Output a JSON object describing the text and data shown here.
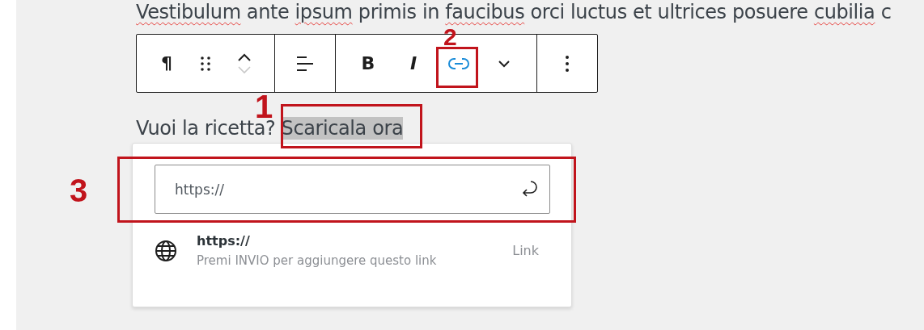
{
  "paragraph_1": [
    {
      "text": "Vestibulum",
      "misspelled": true
    },
    {
      "text": " ante ",
      "misspelled": false
    },
    {
      "text": "ipsum",
      "misspelled": true
    },
    {
      "text": " primis in ",
      "misspelled": false
    },
    {
      "text": "faucibus",
      "misspelled": true
    },
    {
      "text": " orci luctus et ultrices posuere ",
      "misspelled": false
    },
    {
      "text": "cubilia",
      "misspelled": true
    },
    {
      "text": " c",
      "misspelled": false
    }
  ],
  "toolbar": [
    [
      {
        "kind": "paragraph",
        "label": "¶"
      },
      {
        "kind": "drag"
      },
      {
        "kind": "mover"
      }
    ],
    [
      {
        "kind": "align"
      }
    ],
    [
      {
        "kind": "bold",
        "label": "B"
      },
      {
        "kind": "italic",
        "label": "I"
      },
      {
        "kind": "link",
        "active": true
      },
      {
        "kind": "chevron"
      }
    ],
    [
      {
        "kind": "more"
      }
    ]
  ],
  "paragraph_2": [
    {
      "text": "Vuoi la ricetta? ",
      "selected": false
    },
    {
      "text": "Scaricala ora",
      "selected": true
    }
  ],
  "link_popover": {
    "url_field": {
      "value": "https://"
    },
    "suggestion": {
      "title": "https://",
      "subtitle": "Premi INVIO per aggiungere questo link",
      "type": "Link"
    }
  },
  "annotations": [
    {
      "label": "1"
    },
    {
      "label": "2"
    },
    {
      "label": "3"
    }
  ]
}
